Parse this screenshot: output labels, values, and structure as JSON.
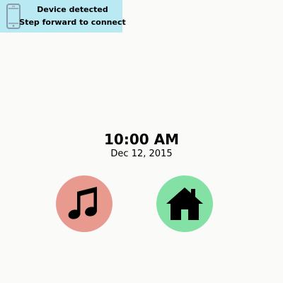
{
  "notification": {
    "icon": "smartphone-icon",
    "title": "Device detected",
    "message": "Step forward to connect",
    "background": "#b9eaf3"
  },
  "clock": {
    "time": "10:00 AM",
    "date": "Dec 12, 2015"
  },
  "buttons": [
    {
      "id": "music",
      "icon": "music-note-icon",
      "color": "#e99a8f"
    },
    {
      "id": "home",
      "icon": "home-icon",
      "color": "#84e1a6"
    }
  ],
  "background_color": "#fafaf8"
}
